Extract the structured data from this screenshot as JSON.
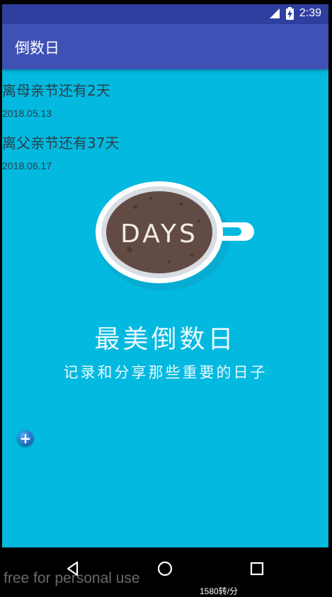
{
  "status_bar": {
    "time": "2:39"
  },
  "app_bar": {
    "title": "倒数日"
  },
  "events": [
    {
      "title": "离母亲节还有2天",
      "date": "2018.05.13"
    },
    {
      "title": "离父亲节还有37天",
      "date": "2018.06.17"
    }
  ],
  "hero": {
    "cup_text": "DAYS",
    "slogan": "最美倒数日",
    "subtitle": "记录和分享那些重要的日子"
  },
  "fab": {
    "icon": "plus-icon"
  },
  "navigation": {
    "back_icon": "back-triangle-icon",
    "home_icon": "home-circle-icon",
    "recents_icon": "recents-square-icon"
  },
  "overlay": {
    "watermark": "free for personal use",
    "speed": "1580转/分"
  },
  "colors": {
    "screen_background": "#03b9e0",
    "app_bar": "#3f51b5",
    "status_bar": "#2f3f9f",
    "fab": "#1565c0"
  }
}
